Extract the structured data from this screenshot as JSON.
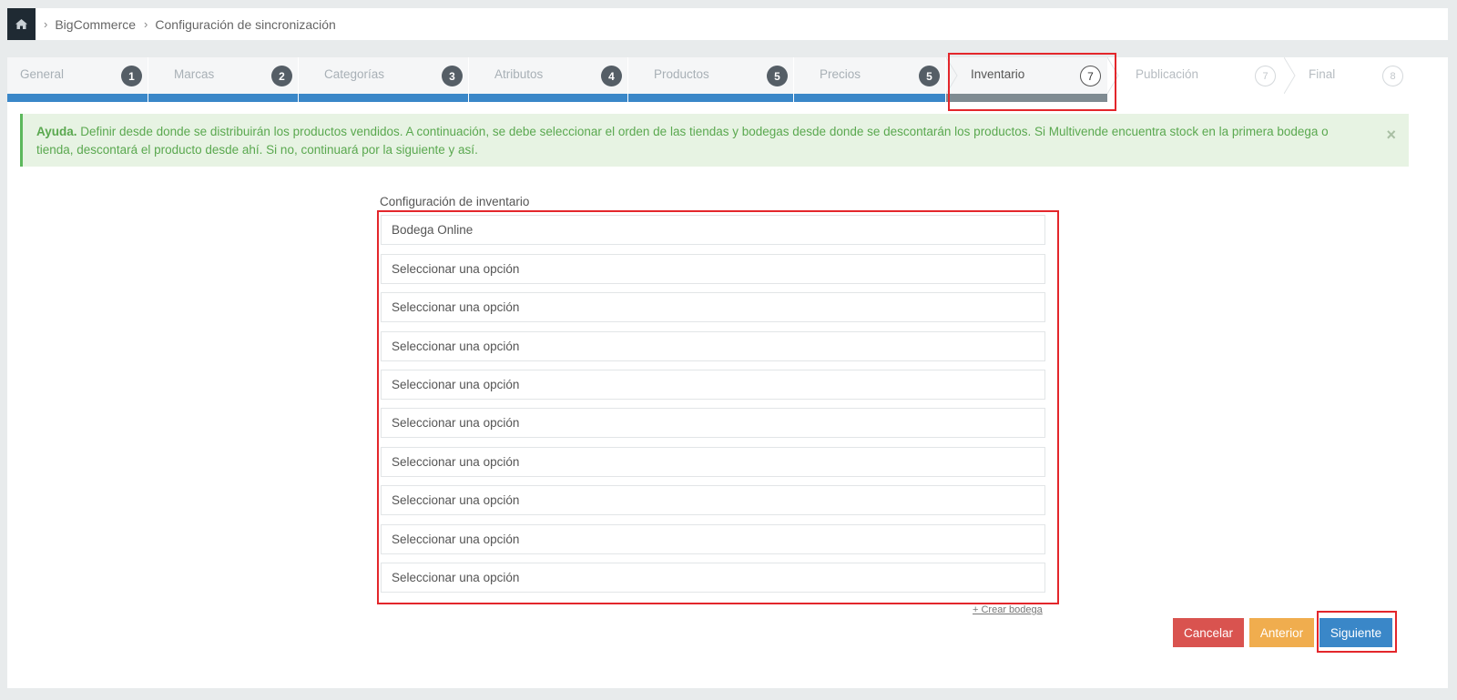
{
  "breadcrumb": {
    "home_icon": "home-icon",
    "items": [
      "BigCommerce",
      "Configuración de sincronización"
    ]
  },
  "wizard": {
    "steps": [
      {
        "label": "General",
        "number": "1",
        "state": "done"
      },
      {
        "label": "Marcas",
        "number": "2",
        "state": "done"
      },
      {
        "label": "Categorías",
        "number": "3",
        "state": "done"
      },
      {
        "label": "Atributos",
        "number": "4",
        "state": "done"
      },
      {
        "label": "Productos",
        "number": "5",
        "state": "done"
      },
      {
        "label": "Precios",
        "number": "5",
        "state": "done"
      },
      {
        "label": "Inventario",
        "number": "7",
        "state": "active"
      },
      {
        "label": "Publicación",
        "number": "7",
        "state": "future"
      },
      {
        "label": "Final",
        "number": "8",
        "state": "future"
      }
    ]
  },
  "alert": {
    "title": "Ayuda.",
    "text": "Definir desde donde se distribuirán los productos vendidos. A continuación, se debe seleccionar el orden de las tiendas y bodegas desde donde se descontarán los productos. Si Multivende encuentra stock en la primera bodega o tienda, descontará el producto desde ahí. Si no, continuará por la siguiente y así.",
    "close": "×"
  },
  "form": {
    "label": "Configuración de inventario",
    "fields": [
      "Bodega Online",
      "Seleccionar una opción",
      "Seleccionar una opción",
      "Seleccionar una opción",
      "Seleccionar una opción",
      "Seleccionar una opción",
      "Seleccionar una opción",
      "Seleccionar una opción",
      "Seleccionar una opción",
      "Seleccionar una opción"
    ],
    "create_link": "+ Crear bodega"
  },
  "buttons": {
    "cancel": "Cancelar",
    "previous": "Anterior",
    "next": "Siguiente"
  },
  "colors": {
    "done_bar": "#3a87c8",
    "active_bar": "#7f8b92",
    "cancel": "#d9534f",
    "previous": "#f0ad4e",
    "next": "#3a87c8",
    "alert_bg": "#e7f3e3",
    "highlight": "#e3262b"
  }
}
